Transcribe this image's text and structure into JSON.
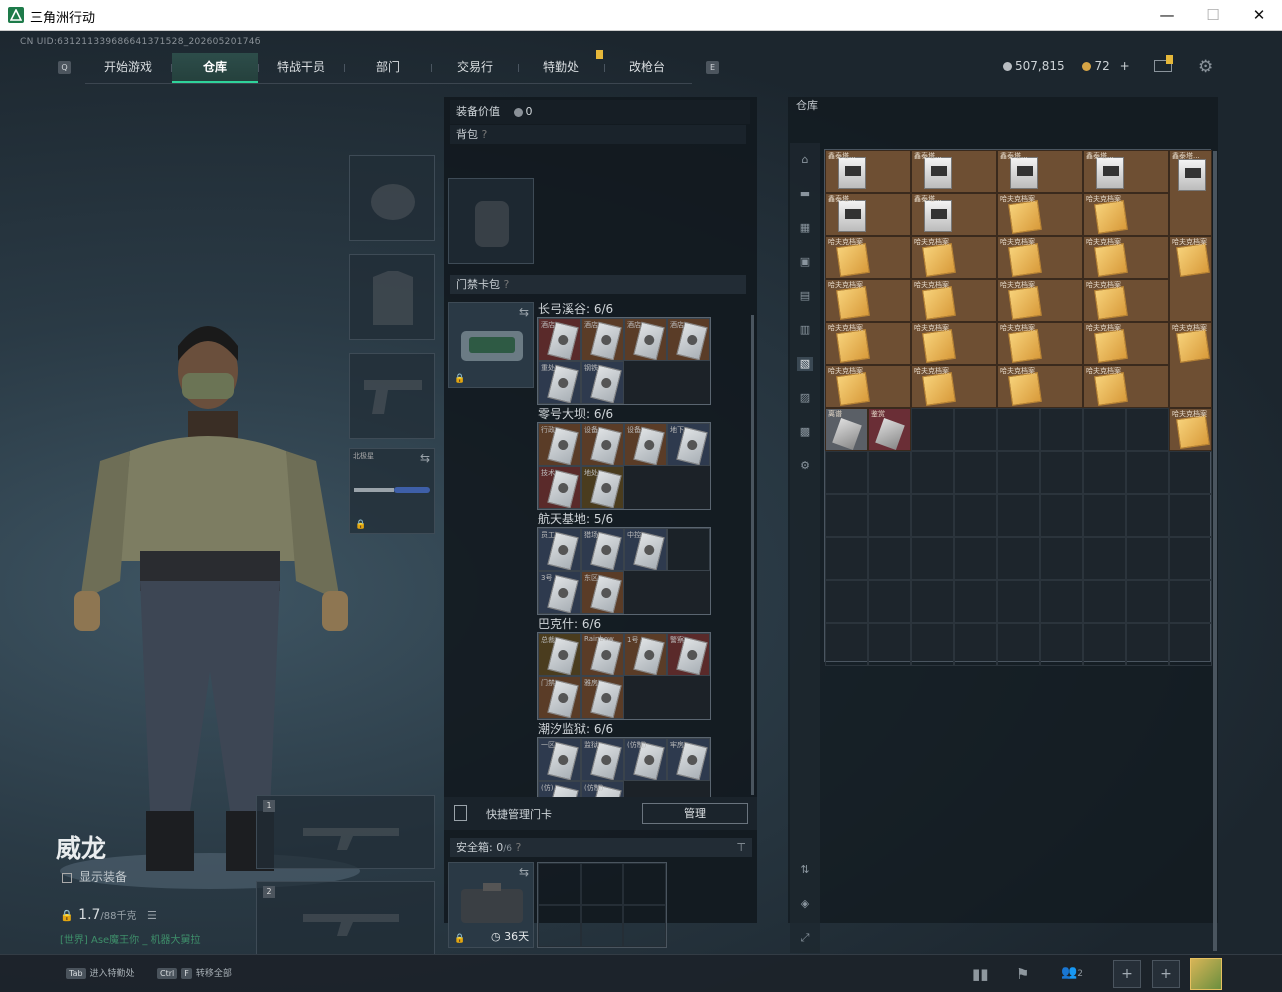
{
  "window": {
    "title": "三角洲行动",
    "minimize": "—",
    "maximize": "☐",
    "close": "✕"
  },
  "uid": "CN UID:631211339686641371528_20260520174б",
  "nav": {
    "left_key": "Q",
    "right_key": "E",
    "tabs": [
      {
        "label": "开始游戏",
        "active": false
      },
      {
        "label": "仓库",
        "active": true
      },
      {
        "label": "特战干员",
        "active": false
      },
      {
        "label": "部门",
        "active": false
      },
      {
        "label": "交易行",
        "active": false
      },
      {
        "label": "特勤处",
        "active": false,
        "badge": true
      },
      {
        "label": "改枪台",
        "active": false
      }
    ]
  },
  "currency": {
    "coins": "507,815",
    "tokens": "72",
    "plus": "+"
  },
  "character": {
    "name": "威龙",
    "show_gear_label": "显示装备",
    "weight": "1.7",
    "weight_max": "/88千克",
    "status_line": "[世界] Ase魔王你 _ 机器大舅拉"
  },
  "left_slots": {
    "melee_label": "北极星",
    "weapon1_num": "1",
    "weapon2_num": "2"
  },
  "middle": {
    "equip_value_label": "装备价值",
    "equip_value": "0",
    "backpack_label": "背包",
    "keycard_label": "门禁卡包",
    "dungeons": [
      {
        "label": "长弓溪谷: 6/6",
        "cards": [
          [
            "r",
            "酒店"
          ],
          [
            "o",
            "酒店"
          ],
          [
            "o",
            "酒店"
          ],
          [
            "o",
            "酒店"
          ],
          [
            "b",
            "重处"
          ],
          [
            "b",
            "钢铁"
          ]
        ]
      },
      {
        "label": "零号大坝: 6/6",
        "cards": [
          [
            "o",
            "行政"
          ],
          [
            "o",
            "设备"
          ],
          [
            "o",
            "设备"
          ],
          [
            "b",
            "地下"
          ],
          [
            "r",
            "技术"
          ],
          [
            "y",
            "地处"
          ]
        ]
      },
      {
        "label": "航天基地: 5/6",
        "cards": [
          [
            "b",
            "员工"
          ],
          [
            "b",
            "猎场"
          ],
          [
            "b",
            "中控"
          ],
          [
            "e",
            ""
          ],
          [
            "b",
            "3号"
          ],
          [
            "o",
            "东区"
          ]
        ]
      },
      {
        "label": "巴克什: 6/6",
        "cards": [
          [
            "y",
            "总裁"
          ],
          [
            "o",
            "Rainbow"
          ],
          [
            "o",
            "1号"
          ],
          [
            "r",
            "警察"
          ],
          [
            "o",
            "门禁"
          ],
          [
            "o",
            "雅房"
          ]
        ]
      },
      {
        "label": "潮汐监狱: 6/6",
        "cards": [
          [
            "b",
            "一区"
          ],
          [
            "b",
            "监狱"
          ],
          [
            "b",
            "(仿制)"
          ],
          [
            "b",
            "牢房"
          ],
          [
            "b",
            "(仿)"
          ],
          [
            "b",
            "(仿制)"
          ]
        ]
      }
    ],
    "quick_manage_label": "快捷管理门卡",
    "manage_button": "管理",
    "safe_box_label": "安全箱:",
    "safe_box_count": "0",
    "safe_box_max": "/6",
    "safe_box_days": "36天"
  },
  "stash": {
    "title": "仓库",
    "items": [
      {
        "type": "box",
        "name": "鑫泰塔...",
        "count": 4,
        "row": 0
      },
      {
        "type": "box",
        "name": "鑫泰塔...",
        "count": 2,
        "row": 1
      },
      {
        "type": "env",
        "name": "哈夫克档案",
        "count": 3,
        "row": 1
      },
      {
        "type": "env",
        "name": "哈夫克档案",
        "count": 4,
        "row": 2
      },
      {
        "type": "env",
        "name": "哈夫克档案",
        "count": 4,
        "row": 3
      },
      {
        "type": "env",
        "name": "哈夫克档案",
        "count": 4,
        "row": 4
      },
      {
        "type": "env",
        "name": "哈夫克档案",
        "count": 4,
        "row": 5
      },
      {
        "type": "extra_box",
        "name": "鑫泰塔..."
      },
      {
        "type": "extra_env",
        "name": "哈夫克档案"
      },
      {
        "type": "extra_env",
        "name": "哈夫克档案"
      }
    ],
    "last_row": [
      {
        "name": "离谱"
      },
      {
        "name": "鉴赏"
      }
    ]
  },
  "bottom": {
    "tab_key": "Tab",
    "tab_action": "进入特勤处",
    "ctrl_key": "Ctrl",
    "f_key": "F",
    "ctrl_action": "转移全部",
    "friends_count": "2",
    "plus1": "+",
    "plus2": "+"
  },
  "colors": {
    "accent": "#2fd39a",
    "panel": "#11181e"
  }
}
